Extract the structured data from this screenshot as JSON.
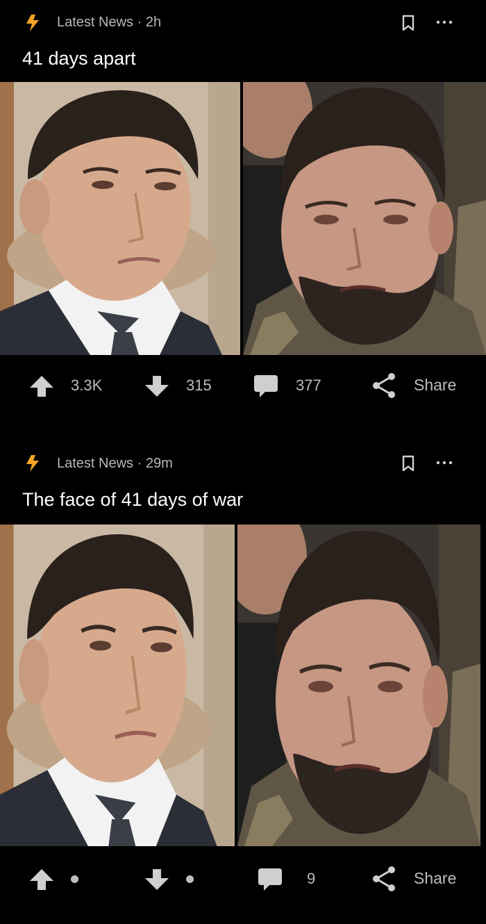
{
  "posts": [
    {
      "source": "Latest News",
      "time": "2h",
      "title": "41 days apart",
      "images": [
        {
          "description": "man in suit and tie, clean-shaven, looking off to the side",
          "palette": "suit"
        },
        {
          "description": "bearded man in olive fleece, tired expression, crowd behind",
          "palette": "fleece"
        }
      ],
      "upvotes": "3.3K",
      "downvotes": "315",
      "comments": "377",
      "share_label": "Share"
    },
    {
      "source": "Latest News",
      "time": "29m",
      "title": "The face of 41 days of war",
      "images": [
        {
          "description": "man in suit and tie, clean-shaven, looking off to the side",
          "palette": "suit"
        },
        {
          "description": "bearded man in olive fleece, tired expression, crowd behind",
          "palette": "fleece"
        }
      ],
      "upvotes": "",
      "downvotes": "",
      "comments": "9",
      "share_label": "Share"
    }
  ],
  "icons": {
    "source": "lightning-icon",
    "save": "bookmark-icon",
    "more": "more-options-icon",
    "upvote": "arrow-up-icon",
    "downvote": "arrow-down-icon",
    "comment": "comment-icon",
    "share": "share-icon"
  },
  "colors": {
    "background": "#000000",
    "lightning": "#f5a623",
    "meta_text": "#b8b8b8",
    "action_text": "#bdbdbd"
  }
}
